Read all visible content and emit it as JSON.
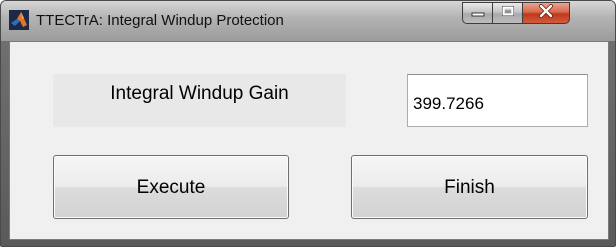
{
  "window": {
    "title": "TTECTrA: Integral Windup Protection",
    "app_icon": "matlab-logo-icon",
    "caption_buttons": {
      "minimize": "minimize-icon",
      "maximize": "maximize-icon",
      "close": "close-icon"
    }
  },
  "form": {
    "gain_label": "Integral Windup Gain",
    "gain_value": "399.7266"
  },
  "actions": {
    "execute_label": "Execute",
    "finish_label": "Finish"
  },
  "colors": {
    "close_button": "#c0391b",
    "panel_background": "#f0f0f0",
    "label_background": "#e8e8e8"
  }
}
